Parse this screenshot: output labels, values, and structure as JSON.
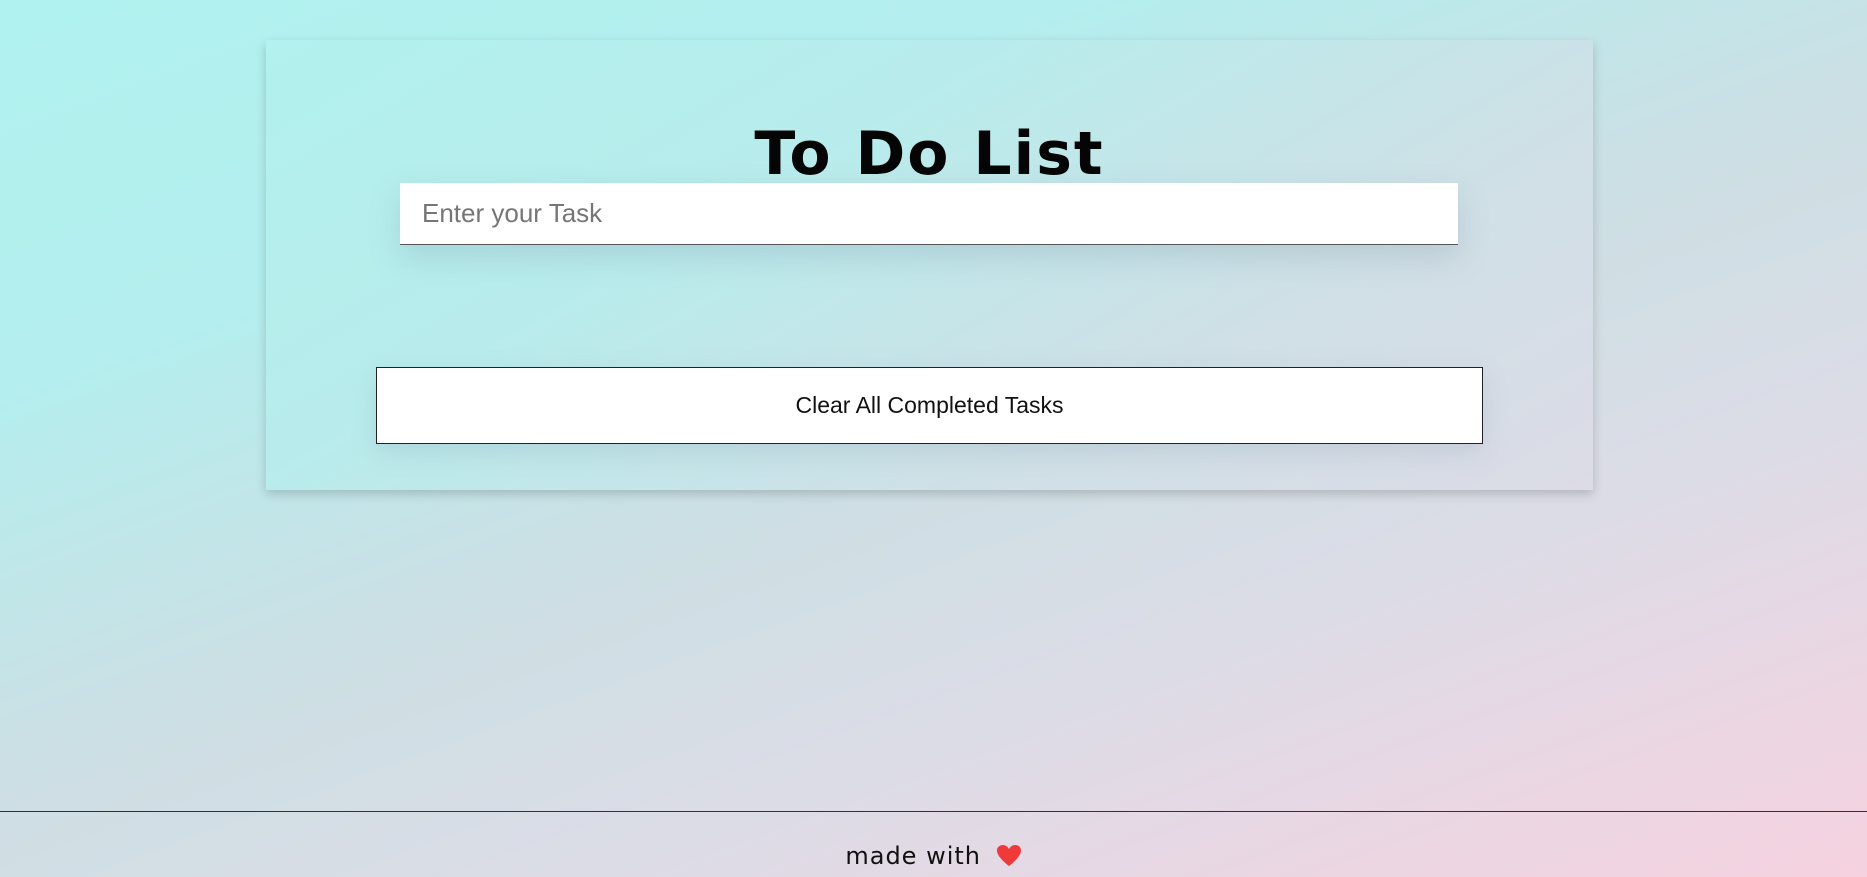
{
  "app": {
    "title": "To Do List"
  },
  "task_input": {
    "placeholder": "Enter your Task",
    "value": ""
  },
  "actions": {
    "clear_completed_label": "Clear All Completed Tasks"
  },
  "footer": {
    "text": "made with",
    "icon": "heart-icon",
    "icon_color": "#f03a3a"
  },
  "colors": {
    "background_start": "#b0f2ef",
    "background_end": "#f6d2e0",
    "text": "#050505"
  }
}
